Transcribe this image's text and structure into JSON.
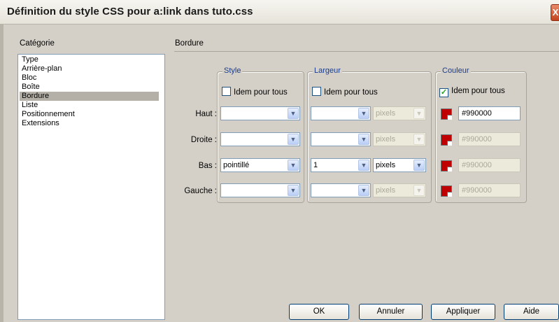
{
  "window": {
    "title": "Définition du style CSS pour a:link dans tuto.css",
    "close": "X"
  },
  "category": {
    "heading": "Catégorie",
    "items": [
      "Type",
      "Arrière-plan",
      "Bloc",
      "Boîte",
      "Bordure",
      "Liste",
      "Positionnement",
      "Extensions"
    ],
    "selected": "Bordure"
  },
  "section_title": "Bordure",
  "groups": {
    "style": {
      "legend": "Style",
      "same_label": "Idem pour tous",
      "same_checked": false
    },
    "width": {
      "legend": "Largeur",
      "same_label": "Idem pour tous",
      "same_checked": false
    },
    "color": {
      "legend": "Couleur",
      "same_label": "Idem pour tous",
      "same_checked": true,
      "check_mark": "✓"
    }
  },
  "rows": [
    {
      "label": "Haut :",
      "style": "",
      "width": "",
      "unit": "pixels",
      "color": "#990000"
    },
    {
      "label": "Droite :",
      "style": "",
      "width": "",
      "unit": "pixels",
      "color": "#990000"
    },
    {
      "label": "Bas :",
      "style": "pointillé",
      "width": "1",
      "unit": "pixels",
      "color": "#990000"
    },
    {
      "label": "Gauche :",
      "style": "",
      "width": "",
      "unit": "pixels",
      "color": "#990000"
    }
  ],
  "buttons": {
    "ok": "OK",
    "cancel": "Annuler",
    "apply": "Appliquer",
    "help": "Aide"
  },
  "icons": {
    "dropdown": "▼"
  },
  "colors": {
    "swatch": "#c00000",
    "selection": "#b4b0a8",
    "legend_text": "#1a3c8c"
  }
}
